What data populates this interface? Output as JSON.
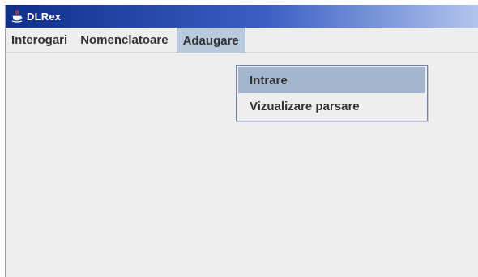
{
  "window": {
    "title": "DLRex",
    "icon": "java-cup-icon"
  },
  "menubar": {
    "items": [
      {
        "label": "Interogari"
      },
      {
        "label": "Nomenclatoare"
      },
      {
        "label": "Adaugare",
        "open": true
      }
    ]
  },
  "popup": {
    "items": [
      {
        "label": "Intrare",
        "selected": true
      },
      {
        "label": "Vizualizare parsare",
        "selected": false
      }
    ]
  },
  "colors": {
    "titlebar_start": "#0e2f8a",
    "titlebar_end": "#b3c5ec",
    "selection": "#a3b6cd",
    "menu_open": "#b8c9dc"
  }
}
